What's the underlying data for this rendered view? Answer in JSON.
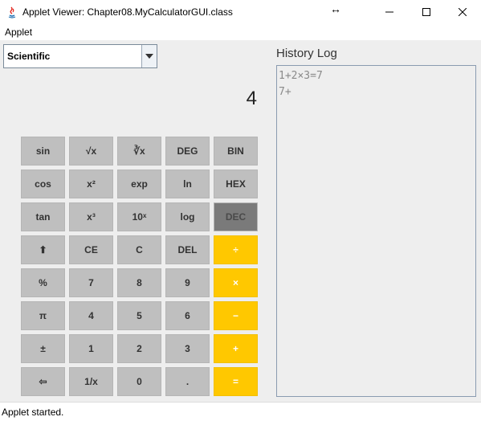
{
  "window": {
    "title": "Applet Viewer: Chapter08.MyCalculatorGUI.class",
    "resize_glyph": "↔",
    "controls": [
      "minimize-icon",
      "maximize-icon",
      "close-icon"
    ]
  },
  "menu": {
    "items": [
      {
        "label": "Applet"
      }
    ]
  },
  "mode_select": {
    "value": "Scientific",
    "arrow_icon": "chevron-down-icon"
  },
  "display": {
    "value": "4"
  },
  "keypad": {
    "rows": [
      [
        {
          "label": "sin"
        },
        {
          "label": "√x"
        },
        {
          "label": "∛x"
        },
        {
          "label": "DEG"
        },
        {
          "label": "BIN"
        }
      ],
      [
        {
          "label": "cos"
        },
        {
          "label": "x²"
        },
        {
          "label": "exp"
        },
        {
          "label": "ln"
        },
        {
          "label": "HEX"
        }
      ],
      [
        {
          "label": "tan"
        },
        {
          "label": "x³"
        },
        {
          "label": "10ˣ"
        },
        {
          "label": "log"
        },
        {
          "label": "DEC",
          "state": "active"
        }
      ],
      [
        {
          "label": "⬆"
        },
        {
          "label": "CE"
        },
        {
          "label": "C"
        },
        {
          "label": "DEL"
        },
        {
          "label": "÷",
          "style": "operator"
        }
      ],
      [
        {
          "label": "%"
        },
        {
          "label": "7"
        },
        {
          "label": "8"
        },
        {
          "label": "9"
        },
        {
          "label": "×",
          "style": "operator"
        }
      ],
      [
        {
          "label": "π"
        },
        {
          "label": "4"
        },
        {
          "label": "5"
        },
        {
          "label": "6"
        },
        {
          "label": "−",
          "style": "operator"
        }
      ],
      [
        {
          "label": "±"
        },
        {
          "label": "1"
        },
        {
          "label": "2"
        },
        {
          "label": "3"
        },
        {
          "label": "+",
          "style": "operator"
        }
      ],
      [
        {
          "label": "⇦"
        },
        {
          "label": "1/x"
        },
        {
          "label": "0"
        },
        {
          "label": "."
        },
        {
          "label": "=",
          "style": "operator"
        }
      ]
    ],
    "colors": {
      "key": "#bfbfbf",
      "active": "#7a7a7a",
      "operator": "#ffc800",
      "operator_text": "#ffffff"
    }
  },
  "history": {
    "title": "History Log",
    "lines": [
      "1+2×3=7",
      "7+"
    ]
  },
  "status": {
    "text": "Applet started."
  }
}
